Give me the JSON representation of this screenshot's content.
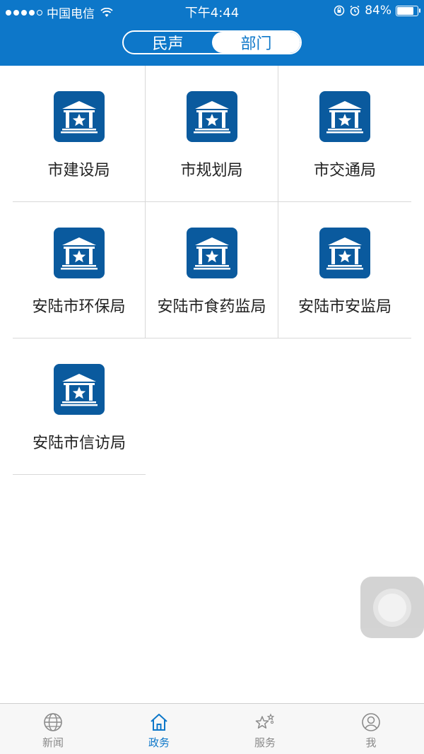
{
  "status_bar": {
    "carrier": "中国电信",
    "time": "下午4:44",
    "battery": "84%",
    "battery_level": 0.84
  },
  "segmented_control": {
    "options": [
      {
        "label": "民声",
        "selected": false
      },
      {
        "label": "部门",
        "selected": true
      }
    ]
  },
  "departments": [
    {
      "label": "市建设局",
      "icon": "government-building-icon"
    },
    {
      "label": "市规划局",
      "icon": "government-building-icon"
    },
    {
      "label": "市交通局",
      "icon": "government-building-icon"
    },
    {
      "label": "安陆市环保局",
      "icon": "government-building-icon"
    },
    {
      "label": "安陆市食药监局",
      "icon": "government-building-icon"
    },
    {
      "label": "安陆市安监局",
      "icon": "government-building-icon"
    },
    {
      "label": "安陆市信访局",
      "icon": "government-building-icon"
    }
  ],
  "tab_bar": {
    "tabs": [
      {
        "label": "新闻",
        "icon": "globe-icon",
        "active": false
      },
      {
        "label": "政务",
        "icon": "home-icon",
        "active": true
      },
      {
        "label": "服务",
        "icon": "stars-icon",
        "active": false
      },
      {
        "label": "我",
        "icon": "user-icon",
        "active": false
      }
    ]
  },
  "colors": {
    "header_blue": "#0d77c9",
    "icon_blue": "#0a5a9e",
    "active_tab": "#0d77c9",
    "inactive_tab": "#8a8a8a"
  }
}
